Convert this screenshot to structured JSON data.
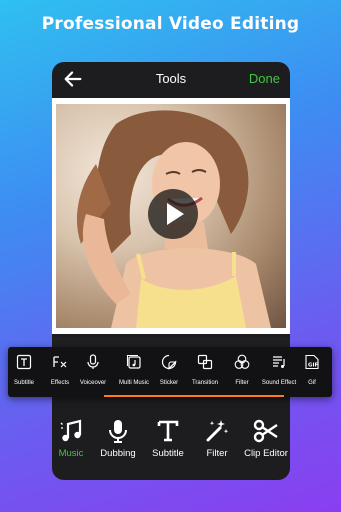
{
  "headline": "Professional Video Editing",
  "topbar": {
    "title": "Tools",
    "done_label": "Done"
  },
  "colors": {
    "accent_green": "#45c545",
    "accent_orange": "#ff7a1a",
    "panel": "#1d1d20"
  },
  "tools": [
    {
      "label": "Subtitle",
      "icon": "subtitle-icon"
    },
    {
      "label": "Effects",
      "icon": "effects-icon"
    },
    {
      "label": "Voiceover",
      "icon": "microphone-icon"
    },
    {
      "label": "Multi Music",
      "icon": "multi-music-icon"
    },
    {
      "label": "Sticker",
      "icon": "sticker-icon"
    },
    {
      "label": "Transition",
      "icon": "transition-icon"
    },
    {
      "label": "Filter",
      "icon": "filter-icon"
    },
    {
      "label": "Sound Effect",
      "icon": "sound-effect-icon"
    },
    {
      "label": "Gif",
      "icon": "gif-icon"
    }
  ],
  "bottom_nav": [
    {
      "label": "Music",
      "icon": "music-icon",
      "active": true
    },
    {
      "label": "Dubbing",
      "icon": "microphone-icon",
      "active": false
    },
    {
      "label": "Subtitle",
      "icon": "text-icon",
      "active": false
    },
    {
      "label": "Filter",
      "icon": "magic-wand-icon",
      "active": false
    },
    {
      "label": "Clip Editor",
      "icon": "scissors-icon",
      "active": false
    }
  ]
}
